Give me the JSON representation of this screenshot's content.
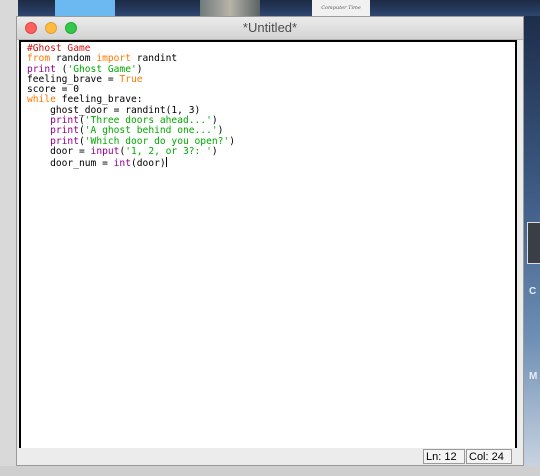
{
  "window": {
    "title": "*Untitled*"
  },
  "background": {
    "tile_text": "Computer Time",
    "right_letter_1": "C",
    "right_letter_2": "M"
  },
  "code_lines": [
    [
      {
        "t": "#Ghost Game",
        "c": "comment"
      }
    ],
    [
      {
        "t": "from",
        "c": "kw"
      },
      {
        "t": " random ",
        "c": ""
      },
      {
        "t": "import",
        "c": "kw"
      },
      {
        "t": " randint",
        "c": ""
      }
    ],
    [
      {
        "t": "print",
        "c": "builtin"
      },
      {
        "t": " (",
        "c": ""
      },
      {
        "t": "'Ghost Game'",
        "c": "str"
      },
      {
        "t": ")",
        "c": ""
      }
    ],
    [
      {
        "t": "feeling_brave = ",
        "c": ""
      },
      {
        "t": "True",
        "c": "kw"
      }
    ],
    [
      {
        "t": "score = 0",
        "c": ""
      }
    ],
    [
      {
        "t": "while",
        "c": "kw"
      },
      {
        "t": " feeling_brave:",
        "c": ""
      }
    ],
    [
      {
        "t": "    ghost_door = randint(1, 3)",
        "c": ""
      }
    ],
    [
      {
        "t": "    ",
        "c": ""
      },
      {
        "t": "print",
        "c": "builtin"
      },
      {
        "t": "(",
        "c": ""
      },
      {
        "t": "'Three doors ahead...'",
        "c": "str"
      },
      {
        "t": ")",
        "c": ""
      }
    ],
    [
      {
        "t": "    ",
        "c": ""
      },
      {
        "t": "print",
        "c": "builtin"
      },
      {
        "t": "(",
        "c": ""
      },
      {
        "t": "'A ghost behind one...'",
        "c": "str"
      },
      {
        "t": ")",
        "c": ""
      }
    ],
    [
      {
        "t": "    ",
        "c": ""
      },
      {
        "t": "print",
        "c": "builtin"
      },
      {
        "t": "(",
        "c": ""
      },
      {
        "t": "'Which door do you open?'",
        "c": "str"
      },
      {
        "t": ")",
        "c": ""
      }
    ],
    [
      {
        "t": "    door = ",
        "c": ""
      },
      {
        "t": "input",
        "c": "builtin"
      },
      {
        "t": "(",
        "c": ""
      },
      {
        "t": "'1, 2, or 3?: '",
        "c": "str"
      },
      {
        "t": ")",
        "c": ""
      }
    ],
    [
      {
        "t": "    door_num = ",
        "c": ""
      },
      {
        "t": "int",
        "c": "builtin"
      },
      {
        "t": "(door)",
        "c": ""
      }
    ]
  ],
  "status": {
    "line": "Ln: 12",
    "column": "Col: 24"
  },
  "colors": {
    "comment": "#d01010",
    "keyword": "#ff7700",
    "builtin": "#900090",
    "string": "#00aa00"
  }
}
